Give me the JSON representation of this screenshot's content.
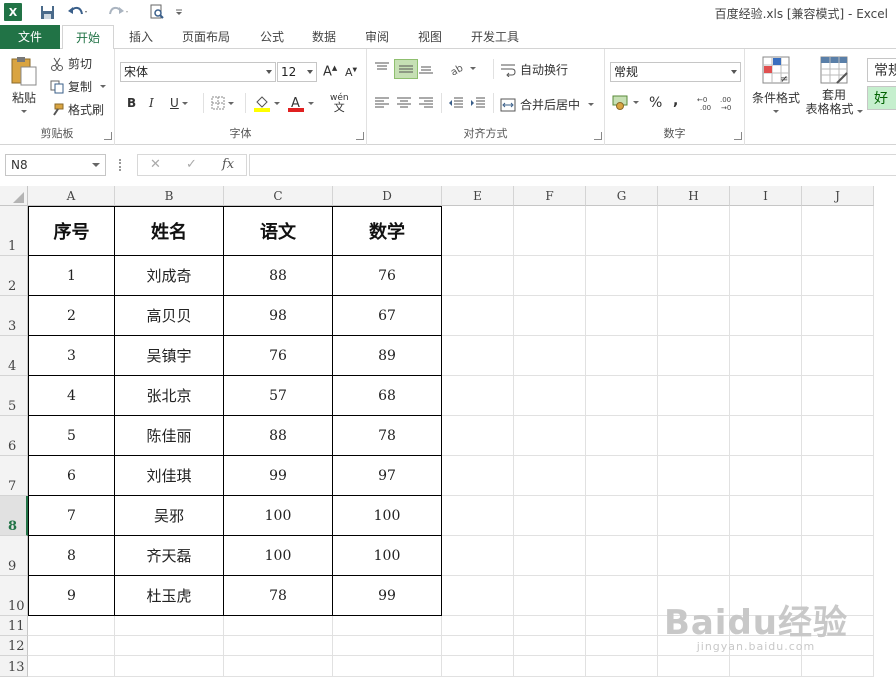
{
  "title_bar": {
    "app_logo": "X",
    "title": "百度经验.xls  [兼容模式] - Excel",
    "icons": [
      "save-icon",
      "undo-icon",
      "redo-icon",
      "print-preview-icon",
      "customize-qat-icon"
    ]
  },
  "tabs": [
    {
      "id": "file",
      "label": "文件"
    },
    {
      "id": "home",
      "label": "开始"
    },
    {
      "id": "insert",
      "label": "插入"
    },
    {
      "id": "page-layout",
      "label": "页面布局"
    },
    {
      "id": "formulas",
      "label": "公式"
    },
    {
      "id": "data",
      "label": "数据"
    },
    {
      "id": "review",
      "label": "审阅"
    },
    {
      "id": "view",
      "label": "视图"
    },
    {
      "id": "developer",
      "label": "开发工具"
    }
  ],
  "ribbon": {
    "clipboard": {
      "paste": "粘贴",
      "cut": "剪切",
      "copy": "复制",
      "format_painter": "格式刷",
      "label": "剪贴板"
    },
    "font": {
      "name": "宋体",
      "size": "12",
      "bold": "B",
      "italic": "I",
      "underline": "U",
      "phonetic": "wén",
      "label": "字体"
    },
    "alignment": {
      "wrap_text": "自动换行",
      "merge_center": "合并后居中",
      "label": "对齐方式"
    },
    "number": {
      "format": "常规",
      "percent": "%",
      "comma": ",",
      "label": "数字"
    },
    "styles": {
      "conditional": "条件格式",
      "table_format_1": "套用",
      "table_format_2": "表格格式",
      "style_normal": "常规",
      "style_good": "好"
    }
  },
  "formula_bar": {
    "name_box": "N8",
    "cancel": "✕",
    "enter": "✓",
    "fx": "fx",
    "value": ""
  },
  "columns": [
    "A",
    "B",
    "C",
    "D",
    "E",
    "F",
    "G",
    "H",
    "I",
    "J"
  ],
  "rows": [
    "1",
    "2",
    "3",
    "4",
    "5",
    "6",
    "7",
    "8",
    "9",
    "10",
    "11",
    "12",
    "13"
  ],
  "selected_row": "8",
  "table": {
    "headers": [
      "序号",
      "姓名",
      "语文",
      "数学"
    ],
    "rows": [
      [
        "1",
        "刘成奇",
        "88",
        "76"
      ],
      [
        "2",
        "高贝贝",
        "98",
        "67"
      ],
      [
        "3",
        "吴镇宇",
        "76",
        "89"
      ],
      [
        "4",
        "张北京",
        "57",
        "68"
      ],
      [
        "5",
        "陈佳丽",
        "88",
        "78"
      ],
      [
        "6",
        "刘佳琪",
        "99",
        "97"
      ],
      [
        "7",
        "吴邪",
        "100",
        "100"
      ],
      [
        "8",
        "齐天磊",
        "100",
        "100"
      ],
      [
        "9",
        "杜玉虎",
        "78",
        "99"
      ]
    ]
  },
  "watermark": {
    "logo": "Baidu经验",
    "url": "jingyan.baidu.com"
  }
}
